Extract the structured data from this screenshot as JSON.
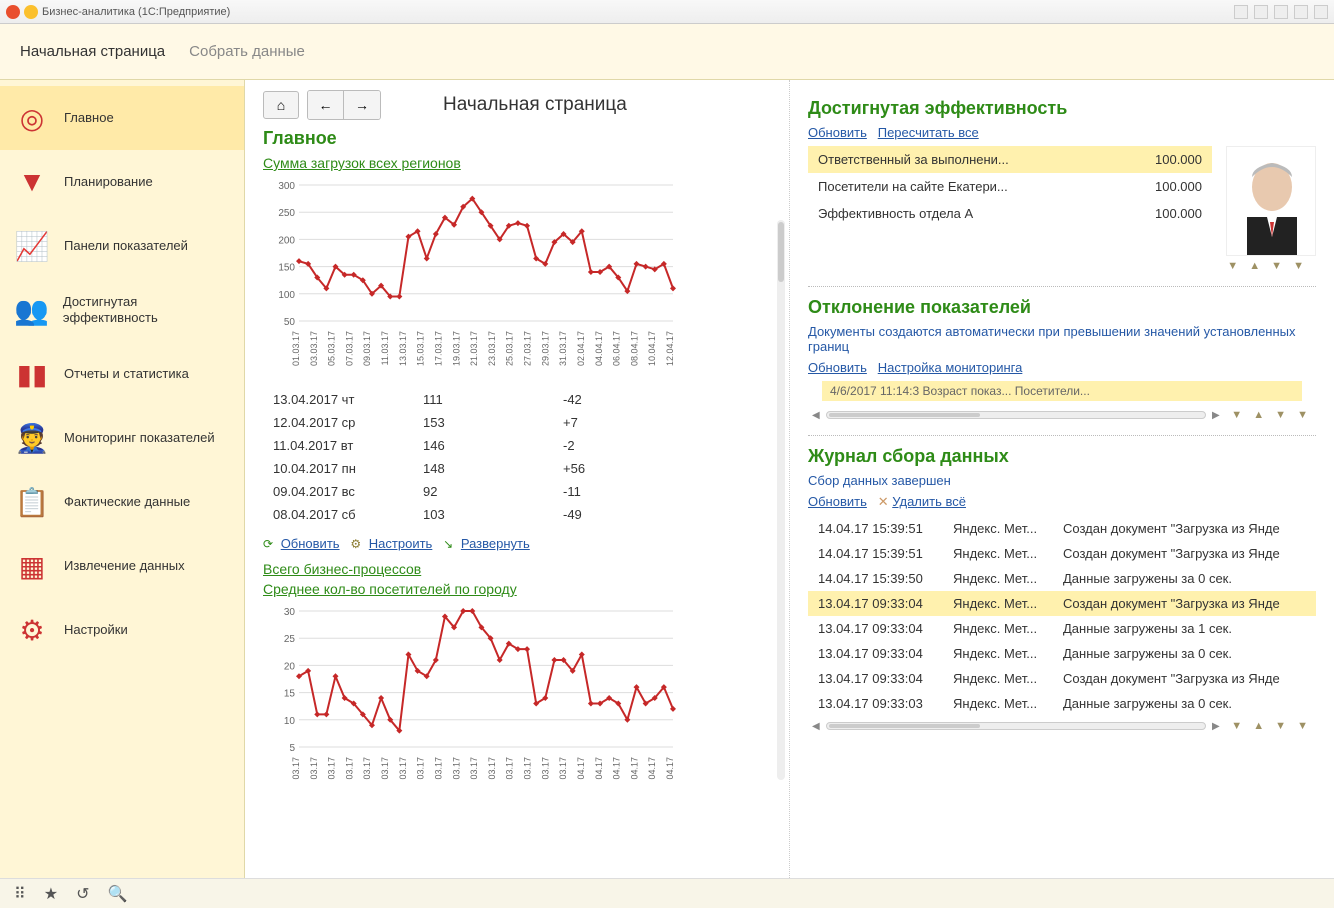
{
  "window": {
    "title": "Бизнес-аналитика  (1С:Предприятие)"
  },
  "breadcrumbs": {
    "main": "Начальная страница",
    "sub": "Собрать данные"
  },
  "sidebar": {
    "items": [
      {
        "label": "Главное",
        "icon": "◎"
      },
      {
        "label": "Планирование",
        "icon": "▼"
      },
      {
        "label": "Панели показателей",
        "icon": "📈"
      },
      {
        "label": "Достигнутая эффективность",
        "icon": "👥"
      },
      {
        "label": "Отчеты и статистика",
        "icon": "▮▮"
      },
      {
        "label": "Мониторинг показателей",
        "icon": "👮"
      },
      {
        "label": "Фактические данные",
        "icon": "📋"
      },
      {
        "label": "Извлечение данных",
        "icon": "▦"
      },
      {
        "label": "Настройки",
        "icon": "⚙"
      }
    ]
  },
  "page_title": "Начальная страница",
  "main_panel": {
    "heading": "Главное",
    "chart1_title": "Сумма загрузок всех регионов",
    "table": [
      {
        "d": "13.04.2017 чт",
        "v": "111",
        "c": "-42"
      },
      {
        "d": "12.04.2017 ср",
        "v": "153",
        "c": "+7"
      },
      {
        "d": "11.04.2017 вт",
        "v": "146",
        "c": "-2"
      },
      {
        "d": "10.04.2017 пн",
        "v": "148",
        "c": "+56"
      },
      {
        "d": "09.04.2017 вс",
        "v": "92",
        "c": "-11"
      },
      {
        "d": "08.04.2017 сб",
        "v": "103",
        "c": "-49"
      }
    ],
    "actions": {
      "refresh": "Обновить",
      "configure": "Настроить",
      "expand": "Развернуть"
    },
    "link2": "Всего бизнес-процессов",
    "chart2_title": "Среднее кол-во посетителей по городу"
  },
  "eff_panel": {
    "heading": "Достигнутая эффективность",
    "links": {
      "refresh": "Обновить",
      "recalc": "Пересчитать все"
    },
    "rows": [
      {
        "name": "Ответственный за выполнени...",
        "val": "100.000"
      },
      {
        "name": "Посетители на сайте Екатери...",
        "val": "100.000"
      },
      {
        "name": "Эффективность отдела А",
        "val": "100.000"
      }
    ]
  },
  "dev_panel": {
    "heading": "Отклонение показателей",
    "note": "Документы создаются автоматически при превышении значений установленных границ",
    "links": {
      "refresh": "Обновить",
      "setup": "Настройка мониторинга"
    },
    "partial": "4/6/2017 11:14:3          Возраст показ...           Посетители..."
  },
  "log_panel": {
    "heading": "Журнал сбора данных",
    "status": "Сбор данных завершен",
    "links": {
      "refresh": "Обновить",
      "delall": "Удалить всё"
    },
    "rows": [
      {
        "t": "14.04.17 15:39:51",
        "s": "Яндекс. Мет...",
        "m": "Создан документ \"Загрузка из Янде"
      },
      {
        "t": "14.04.17 15:39:51",
        "s": "Яндекс. Мет...",
        "m": "Создан документ \"Загрузка из Янде"
      },
      {
        "t": "14.04.17 15:39:50",
        "s": "Яндекс. Мет...",
        "m": "Данные загружены за 0 сек."
      },
      {
        "t": "13.04.17 09:33:04",
        "s": "Яндекс. Мет...",
        "m": "Создан документ \"Загрузка из Янде"
      },
      {
        "t": "13.04.17 09:33:04",
        "s": "Яндекс. Мет...",
        "m": "Данные загружены за 1 сек."
      },
      {
        "t": "13.04.17 09:33:04",
        "s": "Яндекс. Мет...",
        "m": "Данные загружены за 0 сек."
      },
      {
        "t": "13.04.17 09:33:04",
        "s": "Яндекс. Мет...",
        "m": "Создан документ \"Загрузка из Янде"
      },
      {
        "t": "13.04.17 09:33:03",
        "s": "Яндекс. Мет...",
        "m": "Данные загружены за 0 сек."
      }
    ]
  },
  "chart_data": [
    {
      "type": "line",
      "title": "Сумма загрузок всех регионов",
      "ylim": [
        50,
        300
      ],
      "categories": [
        "01.03.17",
        "03.03.17",
        "05.03.17",
        "07.03.17",
        "09.03.17",
        "11.03.17",
        "13.03.17",
        "15.03.17",
        "17.03.17",
        "19.03.17",
        "21.03.17",
        "23.03.17",
        "25.03.17",
        "27.03.17",
        "29.03.17",
        "31.03.17",
        "02.04.17",
        "04.04.17",
        "06.04.17",
        "08.04.17",
        "10.04.17",
        "12.04.17"
      ],
      "values": [
        160,
        155,
        130,
        110,
        150,
        135,
        135,
        125,
        100,
        115,
        95,
        95,
        205,
        215,
        165,
        210,
        240,
        227,
        260,
        275,
        250,
        225,
        200,
        225,
        230,
        225,
        165,
        155,
        195,
        210,
        195,
        215,
        140,
        140,
        150,
        130,
        105,
        155,
        150,
        145,
        155,
        110
      ]
    },
    {
      "type": "line",
      "title": "Среднее кол-во посетителей по городу",
      "ylim": [
        5,
        30
      ],
      "categories": [
        "03.17",
        "03.17",
        "03.17",
        "03.17",
        "03.17",
        "03.17",
        "03.17",
        "03.17",
        "03.17",
        "03.17",
        "03.17",
        "03.17",
        "03.17",
        "03.17",
        "03.17",
        "03.17",
        "04.17",
        "04.17",
        "04.17",
        "04.17",
        "04.17",
        "04.17"
      ],
      "values": [
        18,
        19,
        11,
        11,
        18,
        14,
        13,
        11,
        9,
        14,
        10,
        8,
        22,
        19,
        18,
        21,
        29,
        27,
        30,
        30,
        27,
        25,
        21,
        24,
        23,
        23,
        13,
        14,
        21,
        21,
        19,
        22,
        13,
        13,
        14,
        13,
        10,
        16,
        13,
        14,
        16,
        12
      ]
    }
  ]
}
